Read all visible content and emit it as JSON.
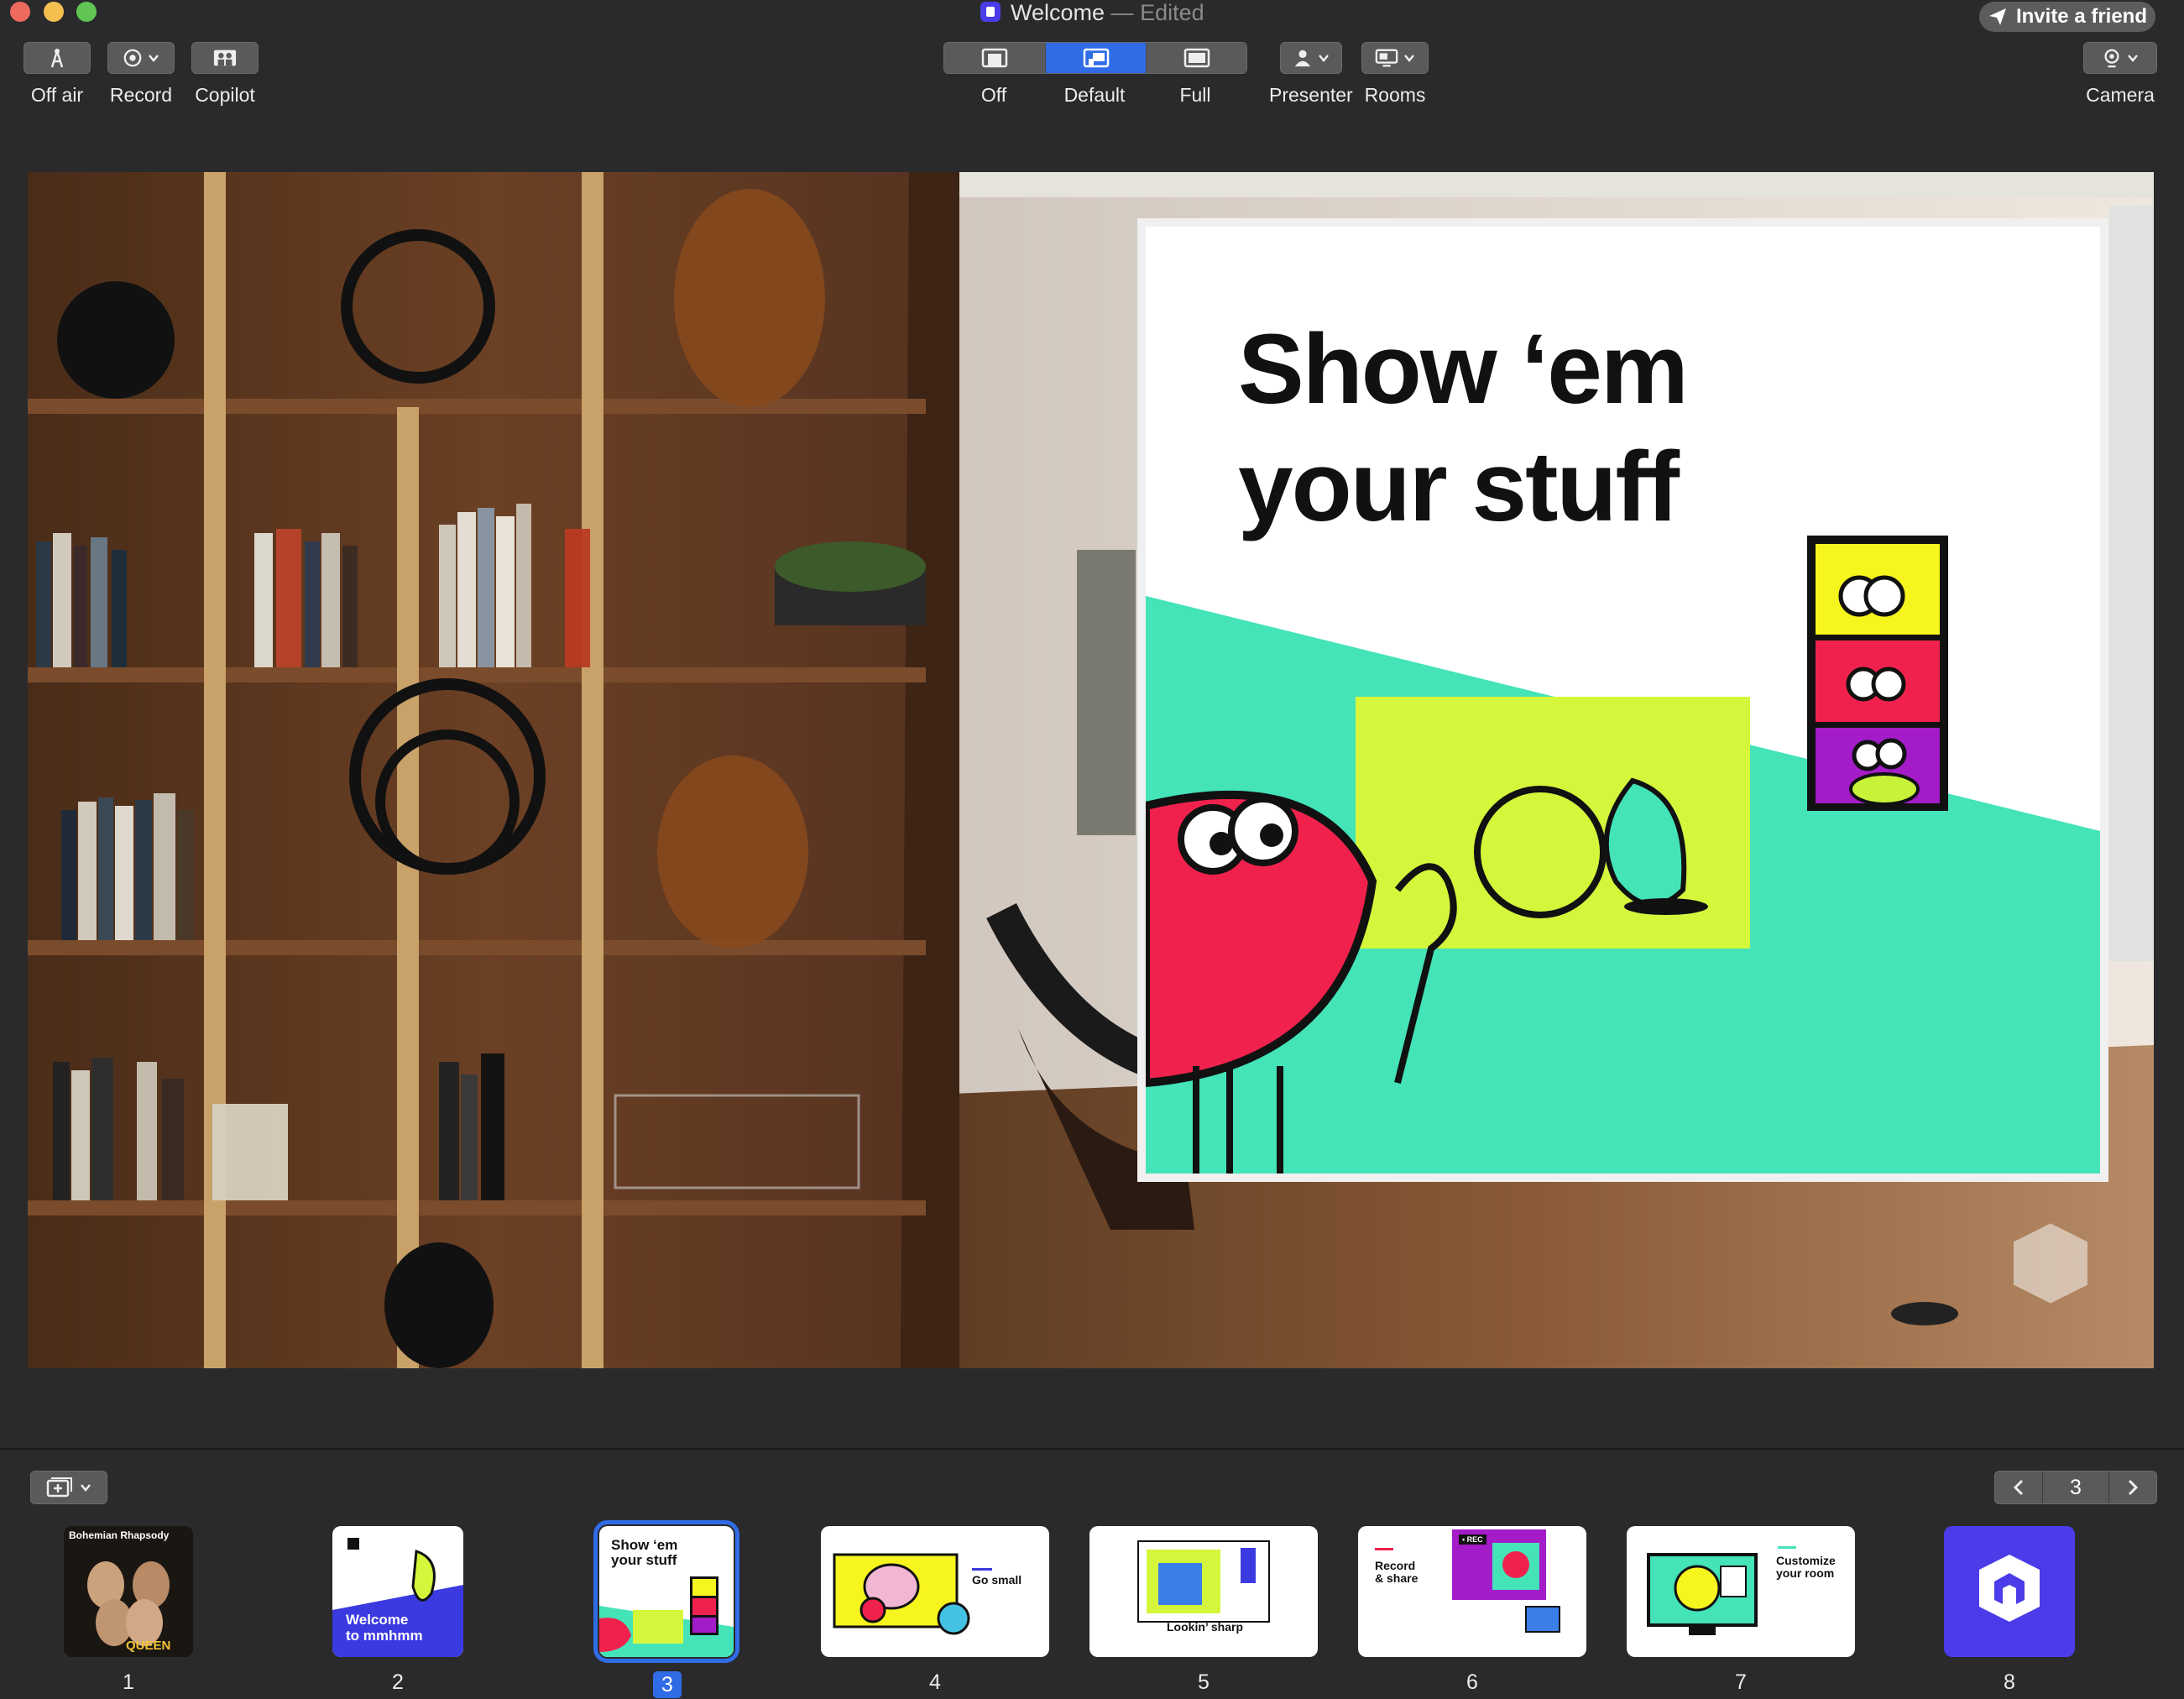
{
  "window": {
    "title": "Welcome",
    "title_separator": " — ",
    "edited_label": "Edited",
    "invite_label": "Invite a friend"
  },
  "toolbar": {
    "off_air": "Off air",
    "record": "Record",
    "copilot": "Copilot",
    "layout_off": "Off",
    "layout_default": "Default",
    "layout_full": "Full",
    "presenter": "Presenter",
    "rooms": "Rooms",
    "camera": "Camera",
    "active_layout": "Default"
  },
  "slide": {
    "title": "Show ‘em\nyour stuff"
  },
  "pager": {
    "current": "3"
  },
  "thumbnails": [
    {
      "number": "1",
      "caption_top": "Bohemian Rhapsody",
      "caption_bottom": "QUEEN"
    },
    {
      "number": "2",
      "caption": "Welcome\nto mmhmm"
    },
    {
      "number": "3",
      "caption": "Show ‘em\nyour stuff",
      "selected": true
    },
    {
      "number": "4",
      "caption": "Go small"
    },
    {
      "number": "5",
      "caption": "Lookin’ sharp"
    },
    {
      "number": "6",
      "caption": "Record\n& share",
      "badge": "• REC"
    },
    {
      "number": "7",
      "caption": "Customize\nyour room"
    },
    {
      "number": "8"
    }
  ],
  "colors": {
    "accent": "#2f6ce6",
    "brand_purple": "#4a3ce8",
    "slide_teal": "#44e3b8",
    "slide_lime": "#d4f73c"
  }
}
